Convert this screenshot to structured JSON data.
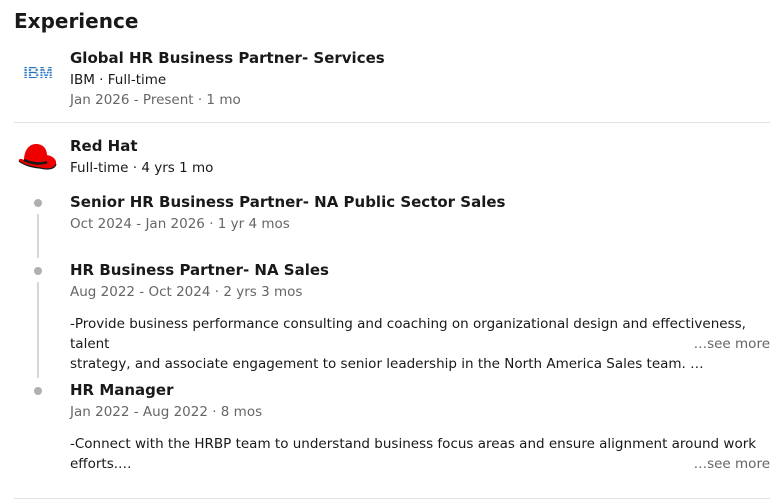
{
  "section": {
    "title": "Experience"
  },
  "ibm": {
    "logo_text": "IBM",
    "title": "Global HR Business Partner- Services",
    "company_line": "IBM · Full-time",
    "dates": "Jan 2026 - Present · 1 mo"
  },
  "redhat": {
    "company": "Red Hat",
    "tenure": "Full-time · 4 yrs 1 mo",
    "roles": [
      {
        "title": "Senior HR Business Partner- NA Public Sector Sales",
        "dates": "Oct 2024 - Jan 2026 · 1 yr 4 mos"
      },
      {
        "title": "HR Business Partner- NA Sales",
        "dates": "Aug 2022 - Oct 2024 · 2 yrs 3 mos",
        "desc_line1": "-Provide business performance consulting and coaching on organizational design and effectiveness, talent",
        "desc_line2": "strategy, and associate engagement to senior leadership in the North America Sales team. …",
        "see_more": "…see more"
      },
      {
        "title": "HR Manager",
        "dates": "Jan 2022 - Aug 2022 · 8 mos",
        "desc_line1": "-Connect with the HRBP team to understand business focus areas and ensure alignment around work",
        "desc_line2": "efforts.…",
        "see_more": "…see more"
      }
    ]
  },
  "colors": {
    "ibm_blue": "#1f70c1",
    "redhat_red": "#ee0000",
    "muted": "#666666"
  }
}
